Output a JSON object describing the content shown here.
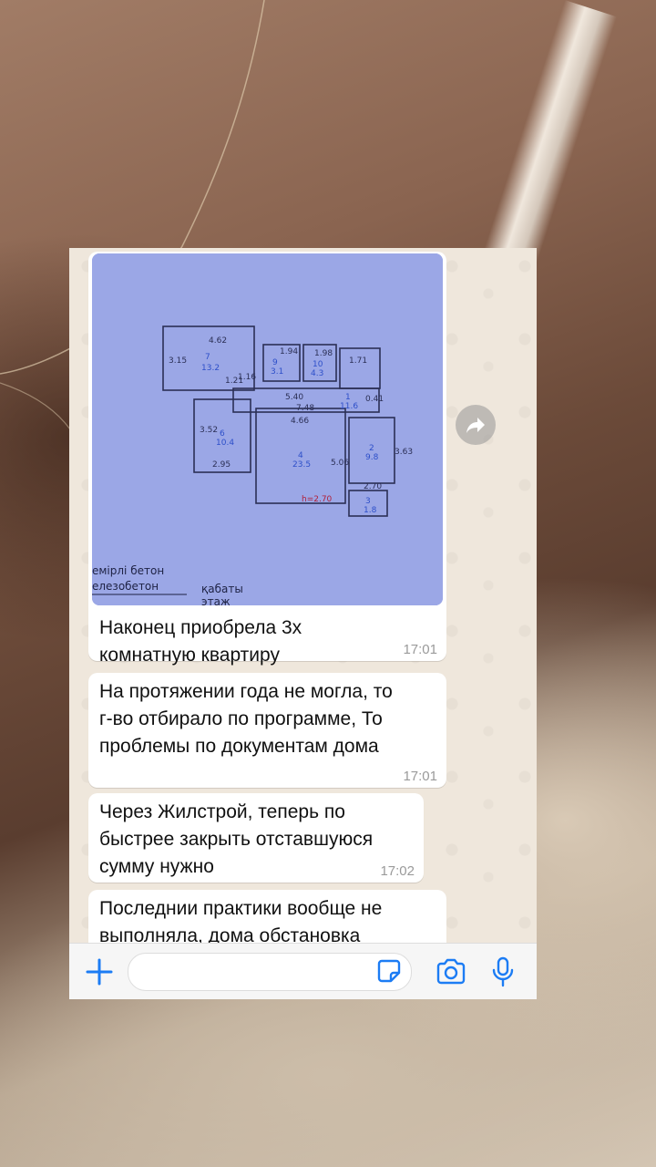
{
  "chat": {
    "plan_caption_lines": [
      "емірлі бетон",
      "елезобетон",
      "қабаты",
      "этаж"
    ],
    "plan_labels": {
      "room7": "7",
      "room7_area": "13.2",
      "room9": "9",
      "room9_area": "3.1",
      "room10": "10",
      "room10_area": "4.3",
      "room6": "6",
      "room6_area": "10.4",
      "room4": "4",
      "room4_area": "23.5",
      "room1": "1",
      "room1_area": "11.6",
      "room2": "2",
      "room2_area": "9.8",
      "room3": "3",
      "room3_area": "1.8",
      "height": "h=2.70",
      "d462": "4.62",
      "d194": "1.94",
      "d198": "1.98",
      "d171": "1.71",
      "d540": "5.40",
      "d748": "7.48",
      "d466": "4.66",
      "d352": "3.52",
      "d295": "2.95",
      "d506": "5.06",
      "d270": "2.70",
      "d363": "3.63",
      "d315": "3.15",
      "d121": "1.21",
      "d116": "1.16",
      "d041": "0.41"
    },
    "messages": [
      {
        "text": "Наконец приобрела 3х\nкомнатную квартиру",
        "time": "17:01"
      },
      {
        "text": "На протяжении года не могла, то\nг-во отбирало по программе, То\nпроблемы по документам  дома",
        "time": "17:01"
      },
      {
        "text": "Через Жилстрой, теперь по\nбыстрее закрыть отставшуюся\nсумму нужно",
        "time": "17:02"
      },
      {
        "text": "Последнии практики вообще не\nвыполняла, дома обстановка",
        "time": ""
      }
    ],
    "input": {
      "placeholder": ""
    },
    "icons": {
      "forward": "forward-icon",
      "plus": "plus-icon",
      "sticker": "sticker-icon",
      "camera": "camera-icon",
      "mic": "microphone-icon"
    },
    "colors": {
      "accent": "#1c7cf4",
      "bubble": "#ffffff",
      "wallpaper": "#efe7dc"
    }
  }
}
